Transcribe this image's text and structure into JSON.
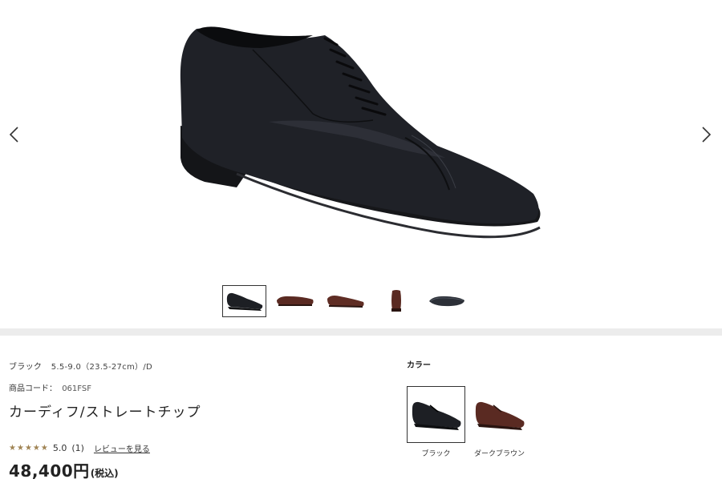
{
  "gallery": {
    "prev_icon": "chevron-left-icon",
    "next_icon": "chevron-right-icon",
    "thumbnails": [
      {
        "icon": "shoe-black-side-thumbnail",
        "active": true
      },
      {
        "icon": "shoe-brown-side-thumbnail",
        "active": false
      },
      {
        "icon": "shoe-brown-pair-thumbnail",
        "active": false
      },
      {
        "icon": "shoe-brown-front-thumbnail",
        "active": false
      },
      {
        "icon": "shoe-sole-thumbnail",
        "active": false
      }
    ]
  },
  "product": {
    "color_name": "ブラック",
    "size_info": "5.5-9.0（23.5-27cm）/D",
    "code_label": "商品コード：",
    "code_value": "061FSF",
    "name": "カーディフ/ストレートチップ",
    "rating_score": "5.0",
    "rating_count": "(1)",
    "review_link": "レビューを見る",
    "stars": 5,
    "price": "48,400円",
    "tax_note": "(税込)"
  },
  "color_selector": {
    "heading": "カラー",
    "options": [
      {
        "label": "ブラック",
        "active": true
      },
      {
        "label": "ダークブラウン",
        "active": false
      }
    ]
  },
  "colors": {
    "star": "#a08454",
    "divider": "#ececec",
    "shoe_black": "#1d1f24",
    "shoe_brown": "#5a2a22"
  }
}
